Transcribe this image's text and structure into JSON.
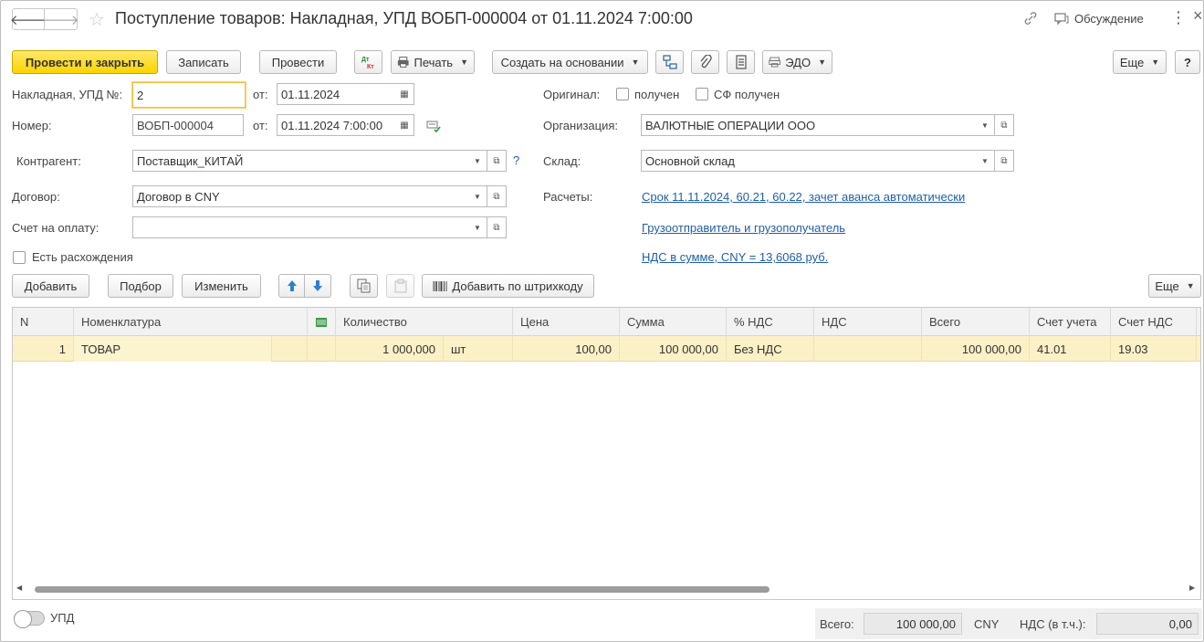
{
  "window": {
    "title": "Поступление товаров: Накладная, УПД ВОБП-000004 от 01.11.2024 7:00:00",
    "discussion_label": "Обсуждение",
    "close_label": "×"
  },
  "toolbar": {
    "post_and_close": "Провести и закрыть",
    "save": "Записать",
    "post": "Провести",
    "dt_kt": "Дт Кт",
    "print": "Печать",
    "create_based_on": "Создать на основании",
    "edo": "ЭДО",
    "more": "Еще",
    "help": "?"
  },
  "form": {
    "invoice_label": "Накладная, УПД №:",
    "invoice_value": "2",
    "from_label": "от:",
    "invoice_date": "01.11.2024",
    "number_label": "Номер:",
    "number_value": "ВОБП-000004",
    "number_date": "01.11.2024  7:00:00",
    "counterparty_label": "Контрагент:",
    "counterparty_value": "Поставщик_КИТАЙ",
    "contract_label": "Договор:",
    "contract_value": "Договор в CNY",
    "payment_invoice_label": "Счет на оплату:",
    "payment_invoice_value": "",
    "discrepancies_label": "Есть расхождения",
    "original_label": "Оригинал:",
    "received_label": "получен",
    "sf_received_label": "СФ получен",
    "organization_label": "Организация:",
    "organization_value": "ВАЛЮТНЫЕ ОПЕРАЦИИ ООО",
    "warehouse_label": "Склад:",
    "warehouse_value": "Основной склад",
    "settlements_label": "Расчеты:",
    "settlements_link": "Срок 11.11.2024, 60.21, 60.22, зачет аванса автоматически",
    "shipper_link": "Грузоотправитель и грузополучатель",
    "vat_link": "НДС в сумме, CNY = 13,6068 руб.",
    "help_mark": "?"
  },
  "table_toolbar": {
    "add": "Добавить",
    "selection": "Подбор",
    "change": "Изменить",
    "barcode": "Добавить по штрихкоду",
    "more": "Еще"
  },
  "table": {
    "headers": {
      "n": "N",
      "nomenclature": "Номенклатура",
      "quantity": "Количество",
      "price": "Цена",
      "sum": "Сумма",
      "vat_rate": "% НДС",
      "vat": "НДС",
      "total": "Всего",
      "account": "Счет учета",
      "vat_account": "Счет НДС"
    },
    "rows": [
      {
        "n": "1",
        "nomenclature": "ТОВАР",
        "quantity": "1 000,000",
        "unit": "шт",
        "price": "100,00",
        "sum": "100 000,00",
        "vat_rate": "Без НДС",
        "vat": "",
        "total": "100 000,00",
        "account": "41.01",
        "vat_account": "19.03"
      }
    ]
  },
  "footer": {
    "upd_label": "УПД",
    "total_label": "Всего:",
    "total_value": "100 000,00",
    "currency": "CNY",
    "vat_label": "НДС (в т.ч.):",
    "vat_value": "0,00"
  },
  "colors": {
    "primary_button": "#fcd400",
    "selected_row": "#fbf0c6",
    "link": "#1f5ea8"
  }
}
